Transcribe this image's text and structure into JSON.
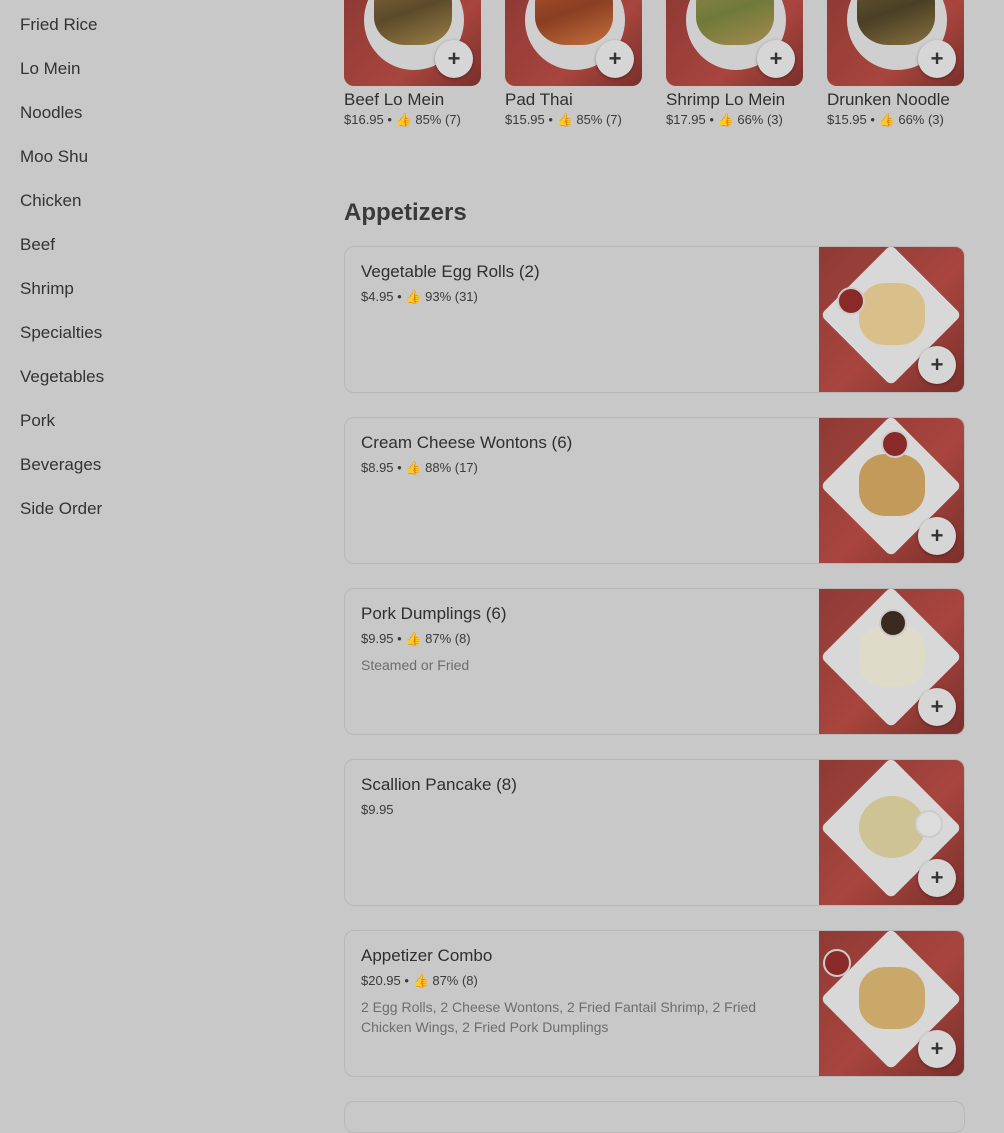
{
  "sidebar": {
    "items": [
      {
        "label": "Fried Rice"
      },
      {
        "label": "Lo Mein"
      },
      {
        "label": "Noodles"
      },
      {
        "label": "Moo Shu"
      },
      {
        "label": "Chicken"
      },
      {
        "label": "Beef"
      },
      {
        "label": "Shrimp"
      },
      {
        "label": "Specialties"
      },
      {
        "label": "Vegetables"
      },
      {
        "label": "Pork"
      },
      {
        "label": "Beverages"
      },
      {
        "label": "Side Order"
      }
    ]
  },
  "top_row": [
    {
      "name": "Beef Lo Mein",
      "meta": "$16.95 • 👍 85% (7)",
      "add": "+"
    },
    {
      "name": "Pad Thai",
      "meta": "$15.95 • 👍 85% (7)",
      "add": "+"
    },
    {
      "name": "Shrimp Lo Mein",
      "meta": "$17.95 • 👍 66% (3)",
      "add": "+"
    },
    {
      "name": "Drunken Noodle",
      "meta": "$15.95 • 👍 66% (3)",
      "add": "+"
    }
  ],
  "section": {
    "title": "Appetizers"
  },
  "items": [
    {
      "name": "Vegetable Egg Rolls (2)",
      "meta": "$4.95 • 👍 93% (31)",
      "desc": "",
      "add": "+"
    },
    {
      "name": "Cream Cheese Wontons (6)",
      "meta": "$8.95 • 👍 88% (17)",
      "desc": "",
      "add": "+"
    },
    {
      "name": "Pork Dumplings (6)",
      "meta": "$9.95 • 👍 87% (8)",
      "desc": "Steamed or Fried",
      "add": "+"
    },
    {
      "name": "Scallion Pancake (8)",
      "meta": "$9.95",
      "desc": "",
      "add": "+"
    },
    {
      "name": "Appetizer Combo",
      "meta": "$20.95 • 👍 87% (8)",
      "desc": "2 Egg Rolls, 2 Cheese Wontons, 2 Fried Fantail Shrimp, 2 Fried Chicken Wings, 2 Fried Pork Dumplings",
      "add": "+"
    }
  ]
}
